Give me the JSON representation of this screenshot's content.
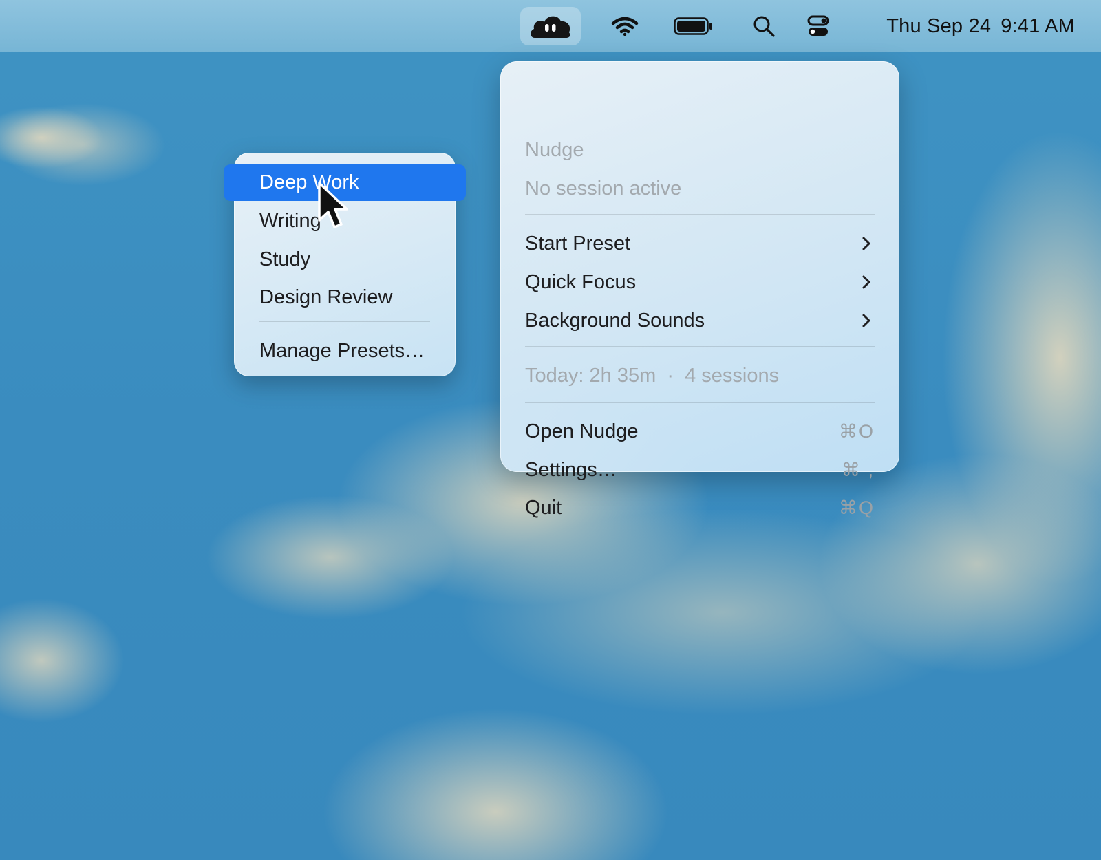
{
  "menubar": {
    "app_icon": "cloud-eyes-icon",
    "status_icons": [
      "wifi-icon",
      "battery-icon",
      "search-icon",
      "control-center-icon"
    ],
    "date": "Thu Sep 24",
    "time": "9:41 AM"
  },
  "menu": {
    "app_name": "Nudge",
    "status": "No session active",
    "items": [
      {
        "label": "Start Preset",
        "submenu": true
      },
      {
        "label": "Quick Focus",
        "submenu": true
      },
      {
        "label": "Background Sounds",
        "submenu": true
      }
    ],
    "today_stats": "Today: 2h 35m  ·  4 sessions",
    "actions": [
      {
        "label": "Open Nudge",
        "shortcut": "⌘O"
      },
      {
        "label": "Settings…",
        "shortcut": "⌘ ,"
      },
      {
        "label": "Quit",
        "shortcut": "⌘Q"
      }
    ]
  },
  "submenu": {
    "items": [
      "Deep Work",
      "Writing",
      "Study",
      "Design Review"
    ],
    "selected": "Deep Work",
    "manage_label": "Manage Presets…"
  },
  "colors": {
    "highlight": "#1f77ee",
    "desktop": "#3c8fc0"
  }
}
